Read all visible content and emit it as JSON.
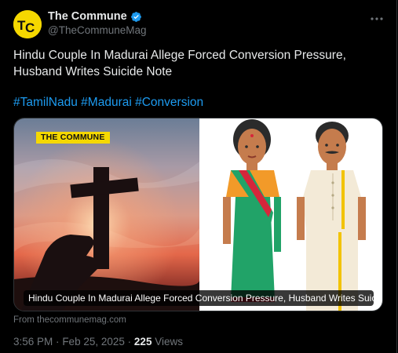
{
  "tweet": {
    "author": {
      "display_name": "The Commune",
      "handle": "@TheCommuneMag",
      "verified": true,
      "avatar_icon": "the-commune-logo",
      "avatar_color": "#f5d800"
    },
    "text": "Hindu Couple In Madurai Allege Forced Conversion Pressure, Husband Writes Suicide Note",
    "hashtags": [
      "#TamilNadu",
      "#Madurai",
      "#Conversion"
    ],
    "media": {
      "badge_part1": "THE",
      "badge_part2": "COMMUNE",
      "caption": "Hindu Couple In Madurai Allege Forced Conversion Pressure, Husband Writes Suicide ..."
    },
    "source": "From thecommunemag.com",
    "time": "3:56 PM",
    "date": "Feb 25, 2025",
    "separator": "·",
    "views_count": "225",
    "views_label": "Views"
  },
  "colors": {
    "background": "#000000",
    "text": "#e7e9ea",
    "muted": "#71767b",
    "link": "#1d9bf0",
    "verified": "#1d9bf0",
    "brand_yellow": "#f5d800"
  },
  "icons": {
    "more": "more-dots-icon",
    "verified": "verified-badge-icon"
  }
}
